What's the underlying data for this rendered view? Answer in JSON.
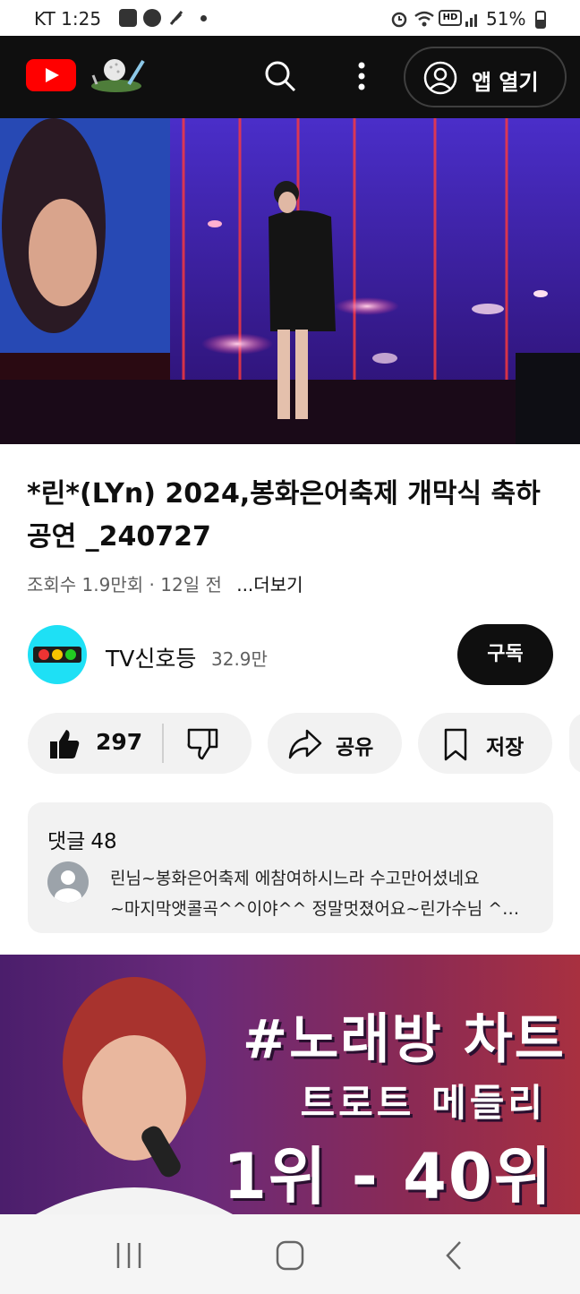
{
  "status_bar": {
    "carrier_time": "KT 1:25",
    "battery": "51%"
  },
  "app_bar": {
    "logo_icon": "youtube-logo-icon",
    "open_app_label": "앱 열기"
  },
  "video": {
    "title": "*린*(LYn) 2024,봉화은어축제 개막식 축하공연 _240727",
    "views": "조회수 1.9만회",
    "separator": "·",
    "age": "12일 전",
    "more": "...더보기"
  },
  "channel": {
    "name": "TV신호등",
    "subscribers": "32.9만",
    "subscribe_label": "구독",
    "avatar_color": "#1ee0f5"
  },
  "actions": {
    "likes": "297",
    "share_label": "공유",
    "save_label": "저장"
  },
  "comments": {
    "label": "댓글",
    "count": "48",
    "preview_line1": "린님~봉화은어축제 에참여하시느라 수고만어셨네요",
    "preview_line2": "~마지막앳콜곡^^이야^^ 정말멋졌어요~린가수님 ^^..."
  },
  "next_video_thumbnail": {
    "line1": "#노래방 차트",
    "line2": "트로트 메들리",
    "line3": "1위 - 40위"
  },
  "colors": {
    "brand_red": "#ff0000",
    "dark": "#0f0f0f",
    "pill_bg": "#f2f2f2"
  }
}
